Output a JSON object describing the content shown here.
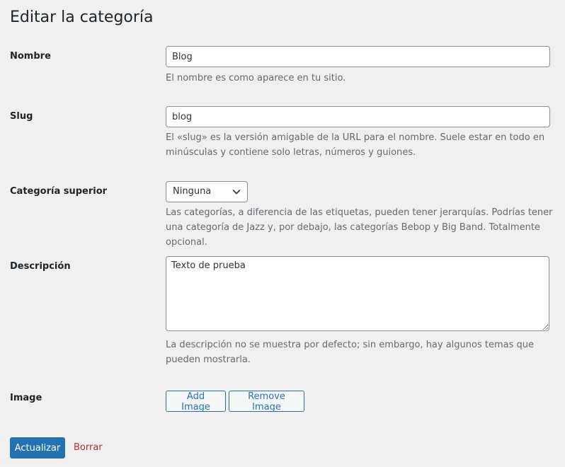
{
  "page": {
    "title": "Editar la categoría"
  },
  "fields": {
    "name": {
      "label": "Nombre",
      "value": "Blog",
      "help": "El nombre es como aparece en tu sitio."
    },
    "slug": {
      "label": "Slug",
      "value": "blog",
      "help": "El «slug» es la versión amigable de la URL para el nombre. Suele estar en todo en minúsculas y contiene solo letras, números y guiones."
    },
    "parent": {
      "label": "Categoría superior",
      "selected": "Ninguna",
      "help": "Las categorías, a diferencia de las etiquetas, pueden tener jerarquías. Podrías tener una categoría de Jazz y, por debajo, las categorías Bebop y Big Band. Totalmente opcional."
    },
    "description": {
      "label": "Descripción",
      "value": "Texto de prueba",
      "help": "La descripción no se muestra por defecto; sin embargo, hay algunos temas que pueden mostrarla."
    },
    "image": {
      "label": "Image",
      "add_label": "Add Image",
      "remove_label": "Remove Image"
    }
  },
  "actions": {
    "update_label": "Actualizar",
    "delete_label": "Borrar"
  },
  "icons": {
    "select": "chevron-down-icon"
  },
  "colors": {
    "background": "#f0f0f1",
    "primary": "#2271b1",
    "delete": "#b32d2e",
    "help_text": "#646970"
  }
}
